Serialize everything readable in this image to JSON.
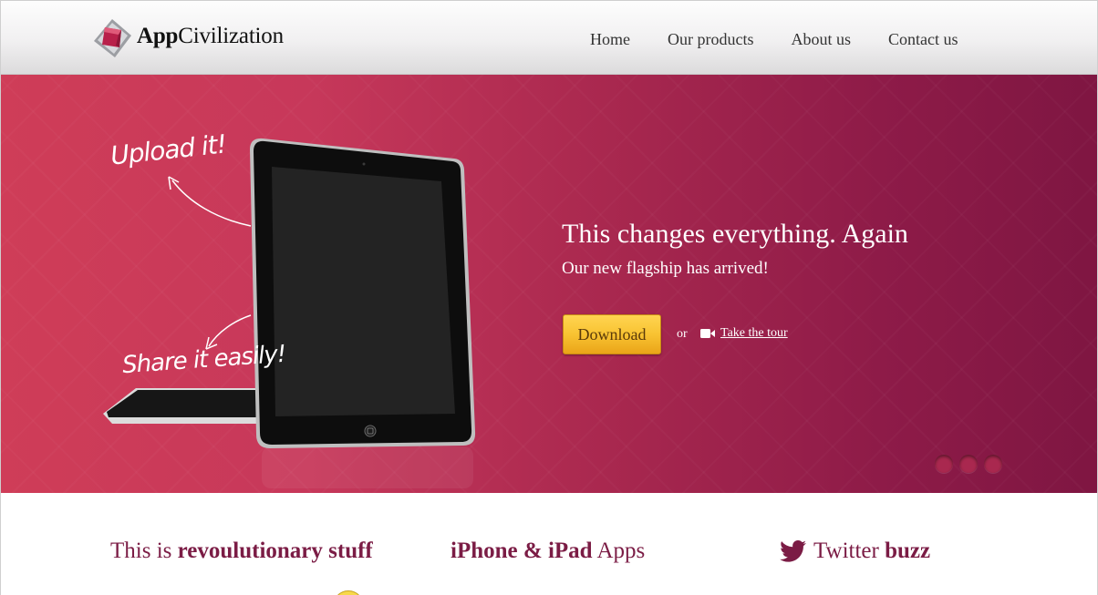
{
  "header": {
    "logo": {
      "bold": "App",
      "regular": "Civilization"
    },
    "nav": [
      {
        "label": "Home"
      },
      {
        "label": "Our products"
      },
      {
        "label": "About us"
      },
      {
        "label": "Contact us"
      }
    ]
  },
  "hero": {
    "handwriting_upload": "Upload it!",
    "handwriting_share": "Share it easily!",
    "title": "This changes everything. Again",
    "subtitle": "Our new flagship has arrived!",
    "download_label": "Download",
    "or_text": "or",
    "tour_label": "Take the tour",
    "slider_dots": 3,
    "active_dot": 0
  },
  "features": {
    "col1": {
      "regular": "This is ",
      "bold": "revoulutionary stuff"
    },
    "col2": {
      "bold1": "iPhone",
      "amp": " & ",
      "bold2": "iPad",
      "regular": " Apps"
    },
    "col3": {
      "regular": "Twitter ",
      "bold": "buzz"
    }
  },
  "colors": {
    "accent": "#7b1c45",
    "hero_left": "#cf3d58",
    "hero_right": "#7f1642",
    "button": "#f8c332"
  },
  "icons": [
    "logo-cube-icon",
    "video-camera-icon",
    "twitter-bird-icon"
  ]
}
